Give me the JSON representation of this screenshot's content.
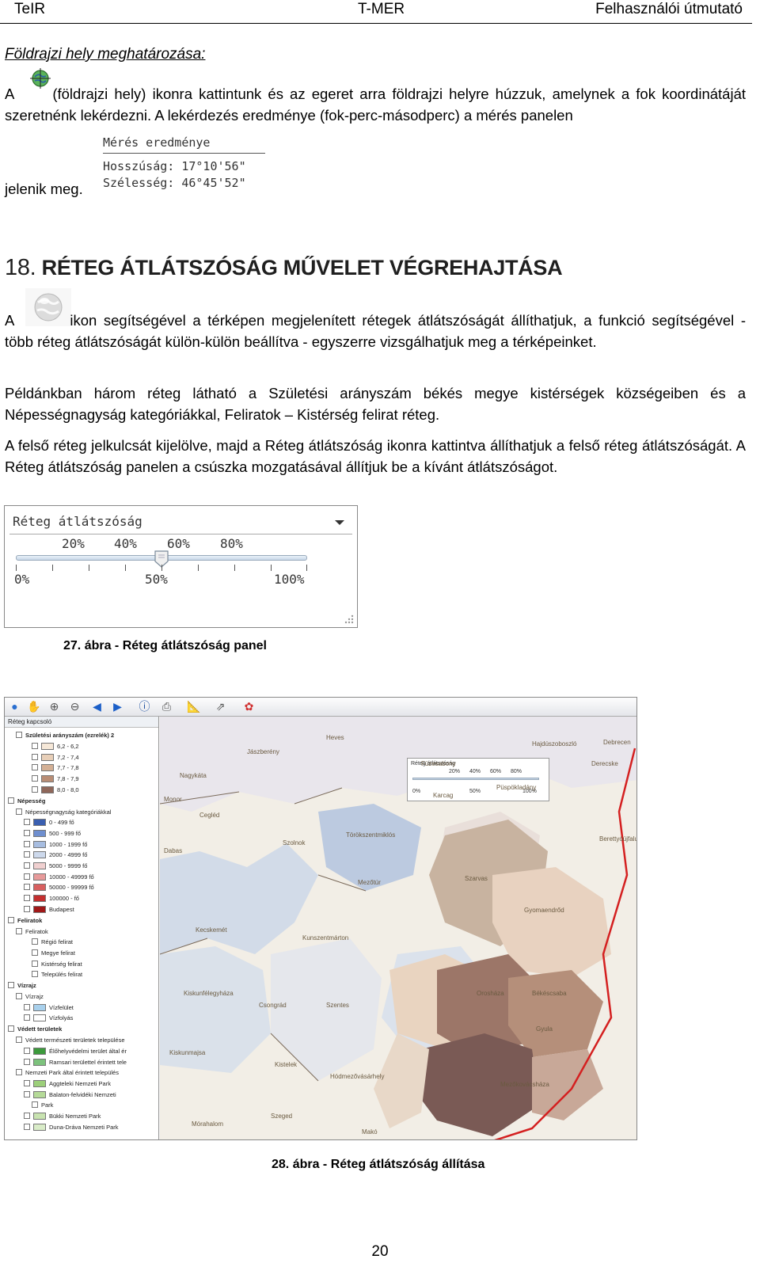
{
  "header": {
    "left": "TeIR",
    "center": "T-MER",
    "right": "Felhasználói útmutató"
  },
  "section_geo": {
    "subheading": "Földrajzi hely meghatározása:",
    "p1_a": "A",
    "p1_b": "(földrajzi hely) ikonra kattintunk és az egeret arra földrajzi helyre húzzuk, amelynek a fok koordinátáját szeretnénk lekérdezni. A lekérdezés eredménye (fok-perc-másodperc) a mérés panelen",
    "p1_end": "jelenik meg.",
    "measure": {
      "title": "Mérés eredménye",
      "lon": "Hosszúság: 17°10'56\"",
      "lat": "Szélesség: 46°45'52\""
    }
  },
  "section18": {
    "number": "18.",
    "title": "RÉTEG ÁTLÁTSZÓSÁG MŰVELET VÉGREHAJTÁSA",
    "p1_a": "A",
    "p1_b": "ikon segítségével a térképen megjelenített rétegek átlátszóságát állíthatjuk, a funkció segítségével - több réteg átlátszóságát külön-külön beállítva - egyszerre vizsgálhatjuk meg a térképeinket.",
    "p2": "Példánkban három réteg látható a Születési arányszám békés megye kistérségek községeiben és a Népességnagyság kategóriákkal, Feliratok – Kistérség felirat réteg.",
    "p3": "A felső réteg jelkulcsát kijelölve, majd a Réteg átlátszóság ikonra kattintva állíthatjuk a felső réteg átlátszóságát. A Réteg átlátszóság panelen a csúszka mozgatásával állítjuk be a kívánt átlátszóságot."
  },
  "opacity_panel": {
    "title": "Réteg átlátszóság",
    "top_ticks": [
      "20%",
      "40%",
      "60%",
      "80%"
    ],
    "bottom_ticks": [
      "0%",
      "50%",
      "100%"
    ],
    "value": 0.5
  },
  "fig27_caption": "27. ábra - Réteg átlátszóság panel",
  "map_figure": {
    "legend_header": "Réteg kapcsoló",
    "layers": [
      {
        "label": "Születési arányszám (ezrelék) 2",
        "bold": true,
        "indent": 1
      },
      {
        "label": "6,2 - 6,2",
        "swatch": "#f6e8d8",
        "indent": 3
      },
      {
        "label": "7,2 - 7,4",
        "swatch": "#e8cfb8",
        "indent": 3
      },
      {
        "label": "7,7 - 7,8",
        "swatch": "#d4b095",
        "indent": 3
      },
      {
        "label": "7,8 - 7,9",
        "swatch": "#b98d75",
        "indent": 3
      },
      {
        "label": "8,0 - 8,0",
        "swatch": "#8f675a",
        "indent": 3
      },
      {
        "label": "Népesség",
        "bold": true,
        "indent": 0
      },
      {
        "label": "Népességnagyság kategóriákkal",
        "indent": 1
      },
      {
        "label": "0 - 499 fő",
        "swatch": "#3a5fb0",
        "indent": 2
      },
      {
        "label": "500 - 999 fő",
        "swatch": "#6f8fcf",
        "indent": 2
      },
      {
        "label": "1000 - 1999 fő",
        "swatch": "#a7bde0",
        "indent": 2
      },
      {
        "label": "2000 - 4999 fő",
        "swatch": "#cdd9ec",
        "indent": 2
      },
      {
        "label": "5000 - 9999 fő",
        "swatch": "#f0d0d0",
        "indent": 2
      },
      {
        "label": "10000 - 49999 fő",
        "swatch": "#e79a9a",
        "indent": 2
      },
      {
        "label": "50000 - 99999 fő",
        "swatch": "#d86060",
        "indent": 2
      },
      {
        "label": "100000 - fő",
        "swatch": "#c43030",
        "indent": 2
      },
      {
        "label": "Budapest",
        "swatch": "#a01818",
        "indent": 2
      },
      {
        "label": "Feliratok",
        "bold": true,
        "indent": 0
      },
      {
        "label": "Feliratok",
        "indent": 1
      },
      {
        "label": "Régió felirat",
        "indent": 3
      },
      {
        "label": "Megye felirat",
        "indent": 3
      },
      {
        "label": "Kistérség felirat",
        "indent": 3
      },
      {
        "label": "Település felirat",
        "indent": 3
      },
      {
        "label": "Vízrajz",
        "bold": true,
        "indent": 0
      },
      {
        "label": "Vízrajz",
        "indent": 1
      },
      {
        "label": "Vízfelület",
        "swatch": "#a8d0ec",
        "indent": 2
      },
      {
        "label": "Vízfolyás",
        "swatch": "#ffffff",
        "indent": 2
      },
      {
        "label": "Védett területek",
        "bold": true,
        "indent": 0
      },
      {
        "label": "Védett természeti területek települése",
        "indent": 1
      },
      {
        "label": "Élőhelyvédelmi terület által ér",
        "swatch": "#3c9a3c",
        "indent": 2
      },
      {
        "label": "Ramsari területtel érintett tele",
        "swatch": "#7dc27d",
        "indent": 2
      },
      {
        "label": "Nemzeti Park által érintett település",
        "indent": 1
      },
      {
        "label": "Aggteleki Nemzeti Park",
        "swatch": "#9ccf7a",
        "indent": 2
      },
      {
        "label": "Balaton-felvidéki Nemzeti",
        "swatch": "#b5da98",
        "indent": 2
      },
      {
        "label": "Park",
        "indent": 3
      },
      {
        "label": "Bükki Nemzeti Park",
        "swatch": "#c8e3b0",
        "indent": 2
      },
      {
        "label": "Duna-Dráva Nemzeti Park",
        "swatch": "#d9ecc8",
        "indent": 2
      }
    ],
    "places": [
      "Cegléd",
      "Heves",
      "Hajdúszoboszló",
      "Debrecen",
      "Jászberény",
      "Derecske",
      "Nagykáta",
      "Füzesabony",
      "Püspökladány",
      "Monor",
      "Karcag",
      "Szolnok",
      "Törökszentmiklós",
      "Berettyóújfalu",
      "Dabas",
      "Mezőtúr",
      "Szarvas",
      "Kecskemét",
      "Kunszentmárton",
      "Gyomaendrőd",
      "Kiskunfélegyháza",
      "Csongrád",
      "Szentes",
      "Orosháza",
      "Békéscsaba",
      "Gyula",
      "Kiskunmajsa",
      "Kistelek",
      "Hódmezővásárhely",
      "Mezőkovácsháza",
      "Szeged",
      "Mórahalom",
      "Makó"
    ],
    "inset": {
      "title": "Réteg átlátszóság",
      "top_ticks": [
        "20%",
        "40%",
        "60%",
        "80%"
      ],
      "bottom_ticks": [
        "0%",
        "50%",
        "100%"
      ]
    }
  },
  "fig28_caption": "28. ábra - Réteg átlátszóság állítása",
  "page_number": "20"
}
